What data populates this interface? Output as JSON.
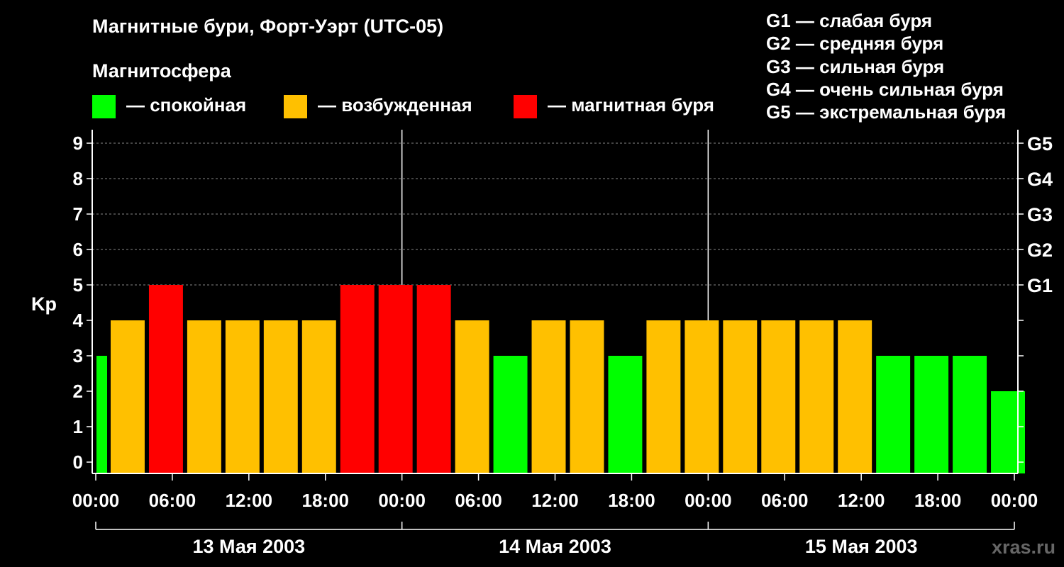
{
  "chart_data": {
    "type": "bar",
    "title": "Магнитные бури, Форт-Уэрт (UTC-05)",
    "subtitle": "Магнитосфера",
    "ylabel": "Kp",
    "ylim": [
      0,
      9
    ],
    "yticks": [
      "0",
      "1",
      "2",
      "3",
      "4",
      "5",
      "6",
      "7",
      "8",
      "9"
    ],
    "g_scale": [
      {
        "level": 5,
        "label": "G1"
      },
      {
        "level": 6,
        "label": "G2"
      },
      {
        "level": 7,
        "label": "G3"
      },
      {
        "level": 8,
        "label": "G4"
      },
      {
        "level": 9,
        "label": "G5"
      }
    ],
    "g_descriptions": [
      "G1 — слабая буря",
      "G2 — средняя буря",
      "G3 — сильная буря",
      "G4 — очень сильная буря",
      "G5 — экстремальная буря"
    ],
    "legend": [
      {
        "label": "— спокойная",
        "color": "#00ff00"
      },
      {
        "label": "— возбужденная",
        "color": "#ffc000"
      },
      {
        "label": "— магнитная буря",
        "color": "#ff0000"
      }
    ],
    "x_tick_labels": [
      "00:00",
      "06:00",
      "12:00",
      "18:00",
      "00:00",
      "06:00",
      "12:00",
      "18:00",
      "00:00",
      "06:00",
      "12:00",
      "18:00",
      "00:00"
    ],
    "dates": [
      "13 Мая 2003",
      "14 Мая 2003",
      "15 Мая 2003"
    ],
    "values": [
      3,
      4,
      5,
      4,
      4,
      4,
      4,
      5,
      5,
      5,
      4,
      3,
      4,
      4,
      3,
      4,
      4,
      4,
      4,
      4,
      4,
      3,
      3,
      3,
      2
    ],
    "colors": [
      "#00ff00",
      "#ffc000",
      "#ff0000"
    ],
    "grid": "dashed horizontal"
  },
  "watermark": "xras.ru"
}
